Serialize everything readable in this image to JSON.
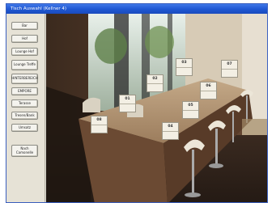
{
  "window": {
    "title": "Tisch Auswahl (Kellner 4)"
  },
  "sidebar": {
    "buttons": [
      {
        "label": "Bar"
      },
      {
        "label": "Hof"
      },
      {
        "label": "Lounge Hof"
      },
      {
        "label": "Lounge Treffe"
      },
      {
        "label": "HINTERBEREICH"
      },
      {
        "label": "EMPORE"
      },
      {
        "label": "Terasse"
      },
      {
        "label": "Tresen/Bank"
      },
      {
        "label": "Umsatz"
      },
      {
        "label": "Nach Camonelle"
      }
    ]
  },
  "tables": [
    {
      "number": "01"
    },
    {
      "number": "02"
    },
    {
      "number": "03"
    },
    {
      "number": "04"
    },
    {
      "number": "05"
    },
    {
      "number": "06"
    },
    {
      "number": "07"
    },
    {
      "number": "08"
    }
  ]
}
